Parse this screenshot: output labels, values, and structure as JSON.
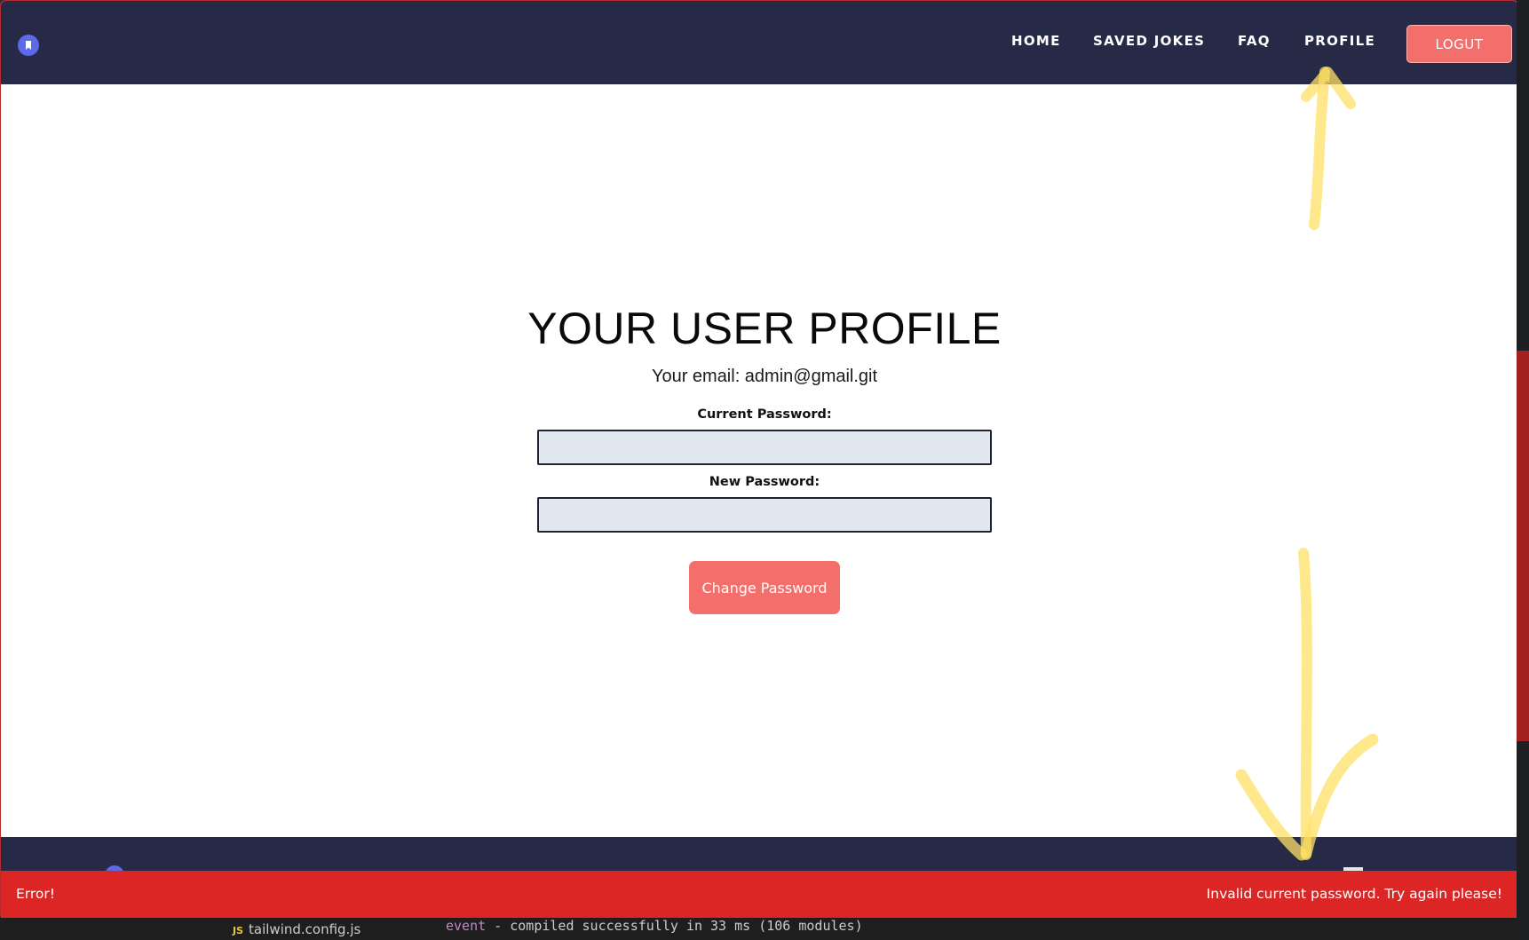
{
  "nav": {
    "links": [
      "HOME",
      "SAVED JOKES",
      "FAQ",
      "PROFILE"
    ],
    "logout_label": "LOGUT"
  },
  "profile": {
    "title": "YOUR USER PROFILE",
    "email_line": "Your email: admin@gmail.git",
    "current_password_label": "Current Password:",
    "new_password_label": "New Password:",
    "current_password_value": "",
    "new_password_value": "",
    "change_button_label": "Change Password"
  },
  "toast": {
    "title": "Error!",
    "message": "Invalid current password. Try again please!"
  },
  "terminal": {
    "file_badge": "JS",
    "file_name": "tailwind.config.js",
    "event_keyword": "event",
    "event_text": " - compiled successfully in 33 ms (106 modules)"
  },
  "colors": {
    "nav_bg": "#262a47",
    "accent_button": "#f26f6c",
    "error_bg": "#dc2626",
    "input_bg": "#e2e8f0",
    "annotation": "#ffe066"
  },
  "icons": {
    "logo": "bookmark-icon",
    "annotations": [
      "arrow-up-annotation",
      "arrow-down-annotation"
    ]
  }
}
